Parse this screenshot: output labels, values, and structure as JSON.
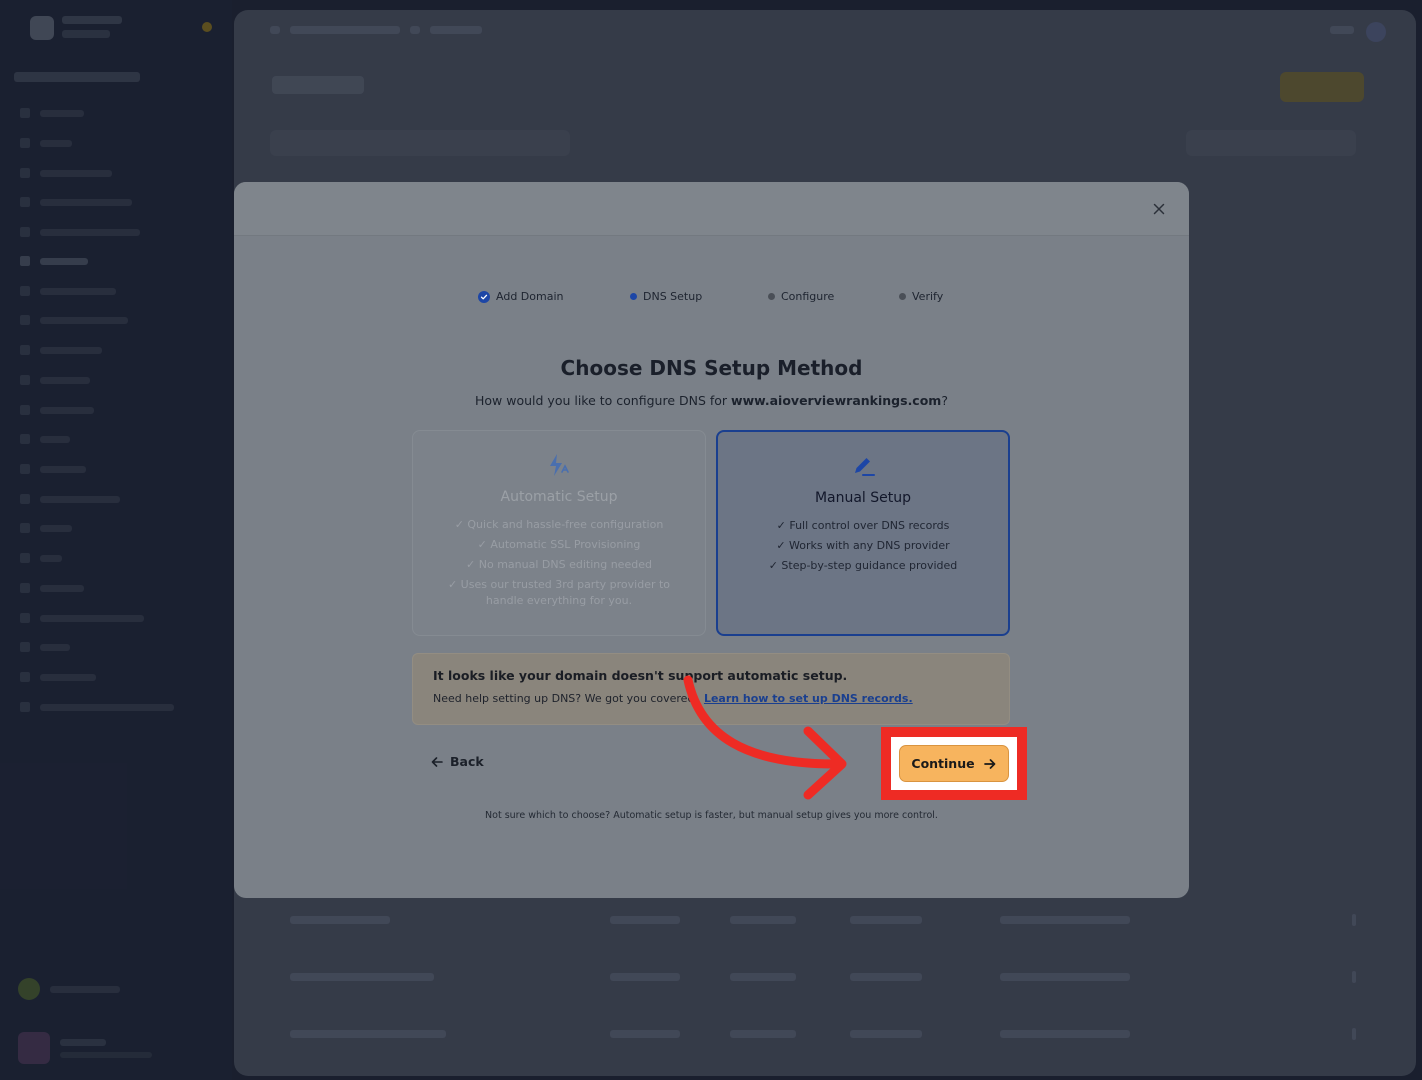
{
  "stepper": {
    "steps": [
      {
        "label": "Add Domain",
        "state": "done"
      },
      {
        "label": "DNS Setup",
        "state": "current"
      },
      {
        "label": "Configure",
        "state": "pending"
      },
      {
        "label": "Verify",
        "state": "pending"
      }
    ]
  },
  "dialog": {
    "heading": "Choose DNS Setup Method",
    "subtitle_prefix": "How would you like to configure DNS for ",
    "domain": "www.aioverviewrankings.com",
    "subtitle_suffix": "?",
    "close_icon": "close-icon"
  },
  "options": {
    "automatic": {
      "title": "Automatic Setup",
      "icon": "lightning-icon",
      "features": [
        "✓ Quick and hassle-free configuration",
        "✓ Automatic SSL Provisioning",
        "✓ No manual DNS editing needed",
        "✓ Uses our trusted 3rd party provider to handle everything for you."
      ]
    },
    "manual": {
      "title": "Manual Setup",
      "icon": "pencil-icon",
      "selected": true,
      "features": [
        "✓ Full control over DNS records",
        "✓ Works with any DNS provider",
        "✓ Step-by-step guidance provided"
      ]
    }
  },
  "notice": {
    "title": "It looks like your domain doesn't support automatic setup.",
    "help_text": "Need help setting up DNS? We got you covered.",
    "link_text": "Learn how to set up DNS records."
  },
  "actions": {
    "back_label": "Back",
    "continue_label": "Continue"
  },
  "footer_hint": "Not sure which to choose? Automatic setup is faster, but manual setup gives you more control.",
  "colors": {
    "accent": "#1d46a6",
    "continue_bg": "#f7b45e",
    "highlight": "#ee2b24"
  }
}
